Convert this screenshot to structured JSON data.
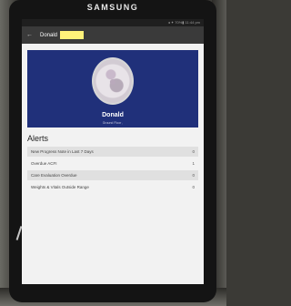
{
  "device": {
    "brand": "SAMSUNG"
  },
  "status_bar": {
    "text": "◂ ✦ 70%▮ 11:44 pm"
  },
  "app_bar": {
    "back_icon": "arrow-left-icon",
    "name": "Donald"
  },
  "profile": {
    "name": "Donald",
    "location": "Ground Floor ,"
  },
  "alerts": {
    "heading": "Alerts",
    "items": [
      {
        "label": "New Progress Note in Last 7 Days",
        "count": "0"
      },
      {
        "label": "Overdue ACFI",
        "count": "1"
      },
      {
        "label": "Care Evaluation Overdue",
        "count": "0"
      },
      {
        "label": "Weights & Vitals Outside Range",
        "count": "0"
      }
    ]
  }
}
